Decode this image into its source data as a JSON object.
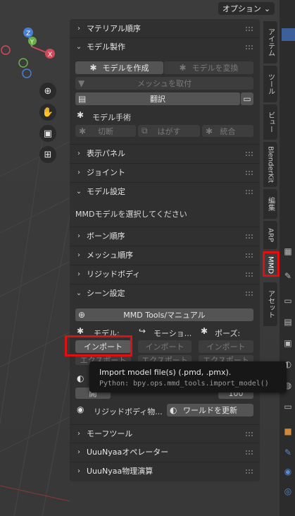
{
  "header": {
    "options_label": "オプション",
    "options_chevron": "⌄"
  },
  "sections": {
    "material_order": "マテリアル順序",
    "model_production": "モデル製作",
    "display_panel": "表示パネル",
    "joint": "ジョイント",
    "model_settings": "モデル設定",
    "bone_order": "ボーン順序",
    "mesh_order": "メッシュ順序",
    "rigid_body": "リジッドボディ",
    "scene_settings": "シーン設定",
    "morph_tools": "モーフツール",
    "uuunyaa_operator": "UuuNyaaオペレーター",
    "uuunyaa_physics": "UuuNyaa物理演算"
  },
  "model_production": {
    "create_model": "モデルを作成",
    "convert_model": "モデルを変換",
    "attach_mesh": "メッシュを取付",
    "translate": "翻訳",
    "model_surgery": "モデル手術",
    "cut": "切断",
    "detach": "はがす",
    "merge": "統合"
  },
  "model_settings": {
    "hint": "MMDモデルを選択してください"
  },
  "scene_settings": {
    "manual": "MMD Tools/マニュアル",
    "col_model": "モデル:",
    "col_motion": "モーショ...",
    "col_pose": "ポーズ:",
    "import": "インポート",
    "export": "エクスポート",
    "partial_1": "開",
    "partial_2": "100",
    "rigid_body_phys": "リジッドボディ物...",
    "world_update": "ワールドを更新"
  },
  "tooltip": {
    "title": "Import model file(s) (.pmd, .pmx).",
    "python": "Python: bpy.ops.mmd_tools.import_model()"
  },
  "tabs": [
    "アイテム",
    "ツール",
    "ビュー",
    "BlenderKit",
    "編集",
    "ARP",
    "MMD",
    "アセット"
  ],
  "colors": {
    "accent_red": "#e01010",
    "panel": "#303030",
    "button": "#545454"
  }
}
